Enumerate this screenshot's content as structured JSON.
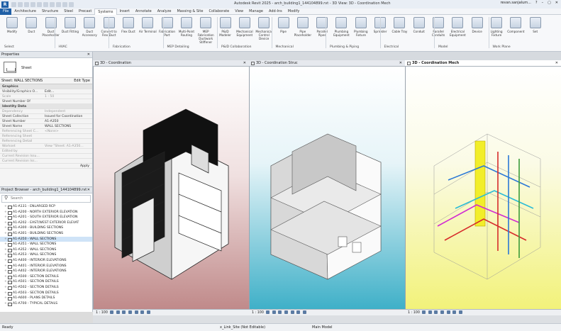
{
  "titlebar": {
    "title": "Autodesk Revit 2025 - arch_building1_144104899.rvt - 3D View: 3D - Coordination Mech",
    "user": "revan.sanjalum...",
    "help": "?"
  },
  "menu": {
    "tabs": [
      "File",
      "Architecture",
      "Structure",
      "Steel",
      "Precast",
      "Systems",
      "Insert",
      "Annotate",
      "Analyze",
      "Massing & Site",
      "Collaborate",
      "View",
      "Manage",
      "Add-Ins",
      "Modify"
    ]
  },
  "ribbon": {
    "tools": [
      "Modify",
      "Duct",
      "Duct Placeholder",
      "Duct Fitting",
      "Duct Accessory",
      "Convert to Flex Duct",
      "Flex Duct",
      "Air Terminal",
      "Fabrication Part",
      "Multi-Point Routing",
      "MEP Fabrication Ductwork Stiffener",
      "P&ID Modeler",
      "Mechanical Equipment",
      "Mechanical Control Device",
      "Pipe",
      "Pipe Placeholder",
      "Parallel Pipes",
      "Plumbing Equipment",
      "Plumbing Fixture",
      "Sprinkler",
      "Cable Tray",
      "Conduit",
      "Parallel Conduits",
      "Electrical Equipment",
      "Device",
      "Lighting Fixture",
      "Component",
      "Set"
    ],
    "groups": [
      "Select",
      "HVAC",
      "Fabrication",
      "MEP Detailing",
      "P&ID Collaboration",
      "Mechanical",
      "Plumbing & Piping",
      "Electrical",
      "Model",
      "Work Plane"
    ]
  },
  "properties": {
    "header": "Properties",
    "type_name": "Sheet",
    "selector": "Sheet: WALL SECTIONS",
    "edit_type": "Edit Type",
    "rows": [
      {
        "k": "Graphics",
        "v": "",
        "cat": true
      },
      {
        "k": "Visibility/Graphics O...",
        "v": "Edit..."
      },
      {
        "k": "Scale",
        "v": "1 : 50",
        "dim": true
      },
      {
        "k": "Sheet Number Of",
        "v": ""
      },
      {
        "k": "Identity Data",
        "v": "",
        "cat": true
      },
      {
        "k": "Dependency",
        "v": "Independent",
        "dim": true
      },
      {
        "k": "Sheet Collection",
        "v": "Issued for Coordination"
      },
      {
        "k": "Sheet Number",
        "v": "A1-A350"
      },
      {
        "k": "Sheet Name",
        "v": "WALL SECTIONS"
      },
      {
        "k": "Referencing Sheet C...",
        "v": "<None>",
        "dim": true
      },
      {
        "k": "Referencing Sheet",
        "v": "",
        "dim": true
      },
      {
        "k": "Referencing Detail",
        "v": "",
        "dim": true
      },
      {
        "k": "Workset",
        "v": "View \"Sheet: A1-A350...",
        "dim": true
      },
      {
        "k": "Edited by",
        "v": "",
        "dim": true
      },
      {
        "k": "Current Revision Issu...",
        "v": "",
        "dim": true
      },
      {
        "k": "Current Revision Iss...",
        "v": "",
        "dim": true
      }
    ],
    "apply": "Apply"
  },
  "browser": {
    "header": "Project Browser - arch_building1_144104899.rvt",
    "search_placeholder": "Search",
    "items": [
      "A1-A131 - ENLARGED RCP",
      "A1-A200 - NORTH EXTERIOR ELEVATION",
      "A1-A201 - SOUTH EXTERIOR ELEVATION",
      "A1-A202 - EAST/WEST EXTERIOR ELEVAT",
      "A1-A300 - BUILDING SECTIONS",
      "A1-A301 - BUILDING SECTIONS",
      "A1-A350 - WALL SECTIONS",
      "A1-A351 - WALL SECTIONS",
      "A1-A352 - WALL SECTIONS",
      "A1-A353 - WALL SECTIONS",
      "A1-A400 - INTERIOR ELEVATIONS",
      "A1-A401 - INTERIOR ELEVATIONS",
      "A1-A402 - INTERIOR ELEVATIONS",
      "A1-A500 - SECTION DETAILS",
      "A1-A501 - SECTION DETAILS",
      "A1-A502 - SECTION DETAILS",
      "A1-A503 - SECTION DETAILS",
      "A1-A600 - PLANS DETAILS",
      "A1-A700 - TYPICAL DETAILS"
    ],
    "selected_index": 6
  },
  "views": [
    {
      "tab": "3D - Coordination",
      "scale": "1 : 100",
      "active": false
    },
    {
      "tab": "3D - Coordination Struc",
      "scale": "1 : 100",
      "active": false
    },
    {
      "tab": "3D - Coordination Mech",
      "scale": "1 : 100",
      "active": true
    }
  ],
  "status": {
    "ready": "Ready",
    "workset": "x_Link_Site (Not Editable)",
    "main_model": "Main Model"
  }
}
